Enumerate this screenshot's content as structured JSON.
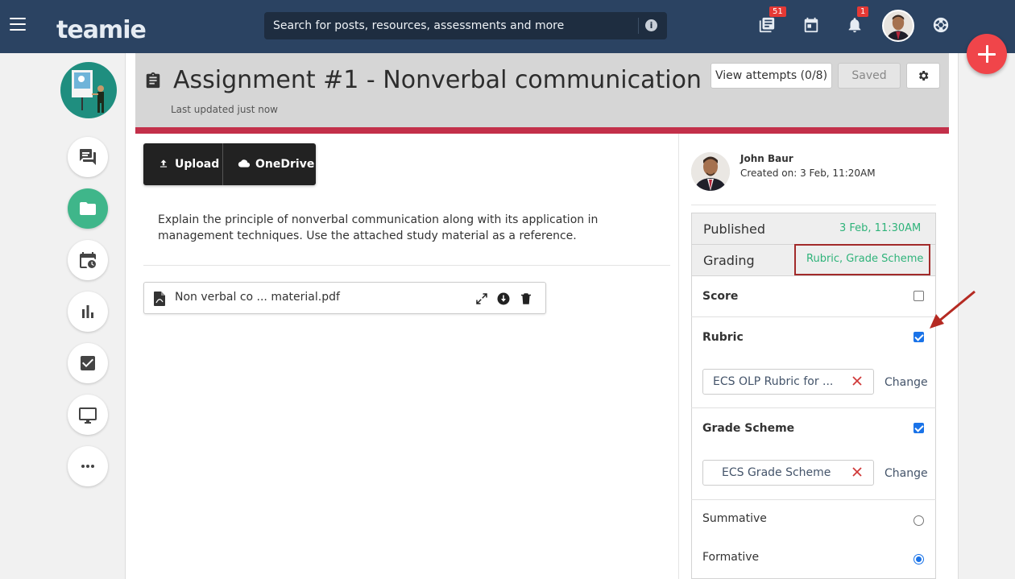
{
  "app": {
    "logo_text": "teamie",
    "search_placeholder": "Search for posts, resources, assessments and more",
    "search_info_glyph": "i",
    "notifications": {
      "library_badge": "51",
      "bell_badge": "1"
    }
  },
  "sidebar": {
    "items": [
      "discussion-icon",
      "folder-icon",
      "calendar-clock-icon",
      "bar-chart-icon",
      "checkbox-icon",
      "monitor-icon",
      "more-icon"
    ],
    "active_item": "folder-icon"
  },
  "header": {
    "title": "Assignment #1 - Nonverbal communication",
    "last_updated": "Last updated just now",
    "view_attempts_label": "View attempts (0/8)",
    "saved_label": "Saved"
  },
  "content": {
    "upload_label": "Upload",
    "onedrive_label": "OneDrive",
    "description": "Explain the principle of nonverbal communication along with its application in management techniques. Use the attached study material as a reference.",
    "attachment_name": "Non verbal co ... material.pdf"
  },
  "panel": {
    "author_name": "John Baur",
    "created_on": "Created on: 3 Feb, 11:20AM",
    "published_label": "Published",
    "published_value": "3 Feb, 11:30AM",
    "grading_label": "Grading",
    "grading_value": "Rubric, Grade Scheme",
    "score_label": "Score",
    "score_checked": false,
    "rubric_label": "Rubric",
    "rubric_checked": true,
    "rubric_value": "ECS OLP Rubric for ...",
    "rubric_change": "Change",
    "grade_scheme_label": "Grade Scheme",
    "grade_scheme_checked": true,
    "grade_scheme_value": "ECS Grade Scheme",
    "grade_scheme_change": "Change",
    "summative_label": "Summative",
    "formative_label": "Formative",
    "selected_assessment_type": "Formative"
  },
  "colors": {
    "topbar": "#2b4362",
    "accent_green": "#2fb37a",
    "header_bar": "#c3304a",
    "fab": "#f0454a",
    "highlight_box": "#a22a2a",
    "checkbox_blue": "#1a73e8"
  }
}
